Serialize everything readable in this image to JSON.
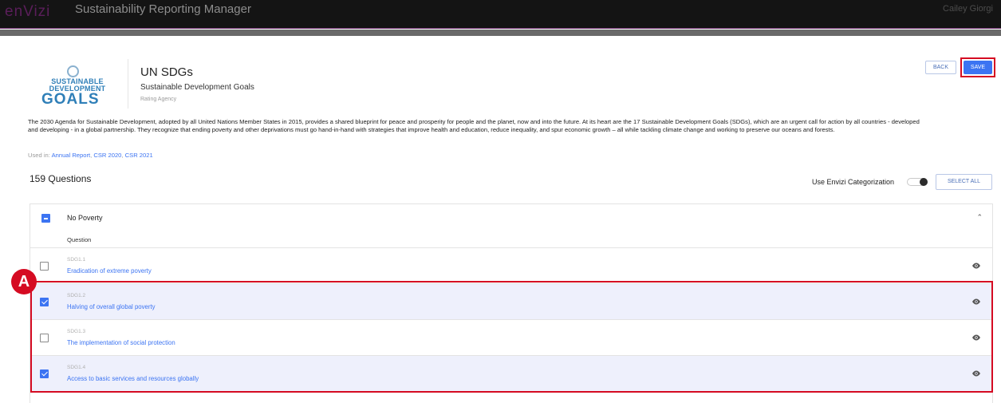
{
  "header": {
    "brand": "enVizi",
    "app_title": "Sustainability Reporting Manager",
    "user_name": "Cailey Giorgi"
  },
  "framework": {
    "logo_lines": [
      "SUSTAINABLE",
      "DEVELOPMENT",
      "GOALS"
    ],
    "title": "UN SDGs",
    "subtitle": "Sustainable Development Goals",
    "type_label": "Rating Agency",
    "description": "The 2030 Agenda for Sustainable Development, adopted by all United Nations Member States in 2015, provides a shared blueprint for peace and prosperity for people and the planet, now and into the future. At its heart are the 17 Sustainable Development Goals (SDGs), which are an urgent call for action by all countries - developed and developing - in a global partnership. They recognize that ending poverty and other deprivations must go hand-in-hand with strategies that improve health and education, reduce inequality, and spur economic growth – all while tackling climate change and working to preserve our oceans and forests.",
    "used_in_label": "Used in: ",
    "used_in": [
      "Annual Report",
      "CSR 2020",
      "CSR 2021"
    ]
  },
  "actions": {
    "back_label": "BACK",
    "save_label": "SAVE"
  },
  "questions": {
    "count_label": "159 Questions",
    "envizi_categorization_label": "Use Envizi Categorization",
    "envizi_categorization_on": true,
    "select_all_label": "SELECT ALL",
    "group_title": "No Poverty",
    "column_header": "Question",
    "rows": [
      {
        "code": "SDG1.1",
        "title": "Eradication of extreme poverty",
        "checked": false
      },
      {
        "code": "SDG1.2",
        "title": "Halving of overall global poverty",
        "checked": true
      },
      {
        "code": "SDG1.3",
        "title": "The implementation of social protection",
        "checked": false
      },
      {
        "code": "SDG1.4",
        "title": "Access to basic services and resources globally",
        "checked": true
      }
    ]
  },
  "annotation": {
    "marker_label": "A",
    "highlight_color": "#d50b22"
  },
  "colors": {
    "accent": "#3c74f2",
    "selected_row": "#eef0fc",
    "topbar": "#141414"
  },
  "icons": [
    "un-emblem-icon",
    "toggle-icon",
    "chevron-up-icon",
    "eye-icon",
    "checkbox-icon"
  ]
}
